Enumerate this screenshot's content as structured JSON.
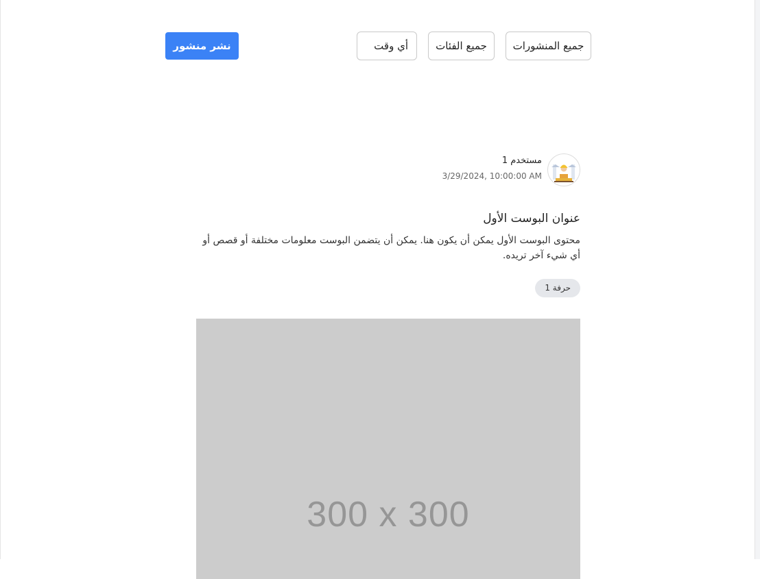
{
  "filters": {
    "posts": "جميع المنشورات",
    "categories": "جميع الفئات",
    "time": "أي وقت"
  },
  "toolbar": {
    "publish_label": "نشر منشور"
  },
  "post": {
    "author": "مستخدم 1",
    "date": "3/29/2024, 10:00:00 AM",
    "title": "عنوان البوست الأول",
    "body": "محتوى البوست الأول يمكن أن يكون هنا. يمكن أن يتضمن البوست معلومات مختلفة أو قصص أو أي شيء آخر تريده.",
    "tag": "حرفة 1",
    "image_label": "300 x 300",
    "avatar_icon": "worker-avatar-icon"
  },
  "colors": {
    "primary": "#3b82f6",
    "image_placeholder": "#cccccc",
    "tag_bg": "#e5e7eb"
  }
}
